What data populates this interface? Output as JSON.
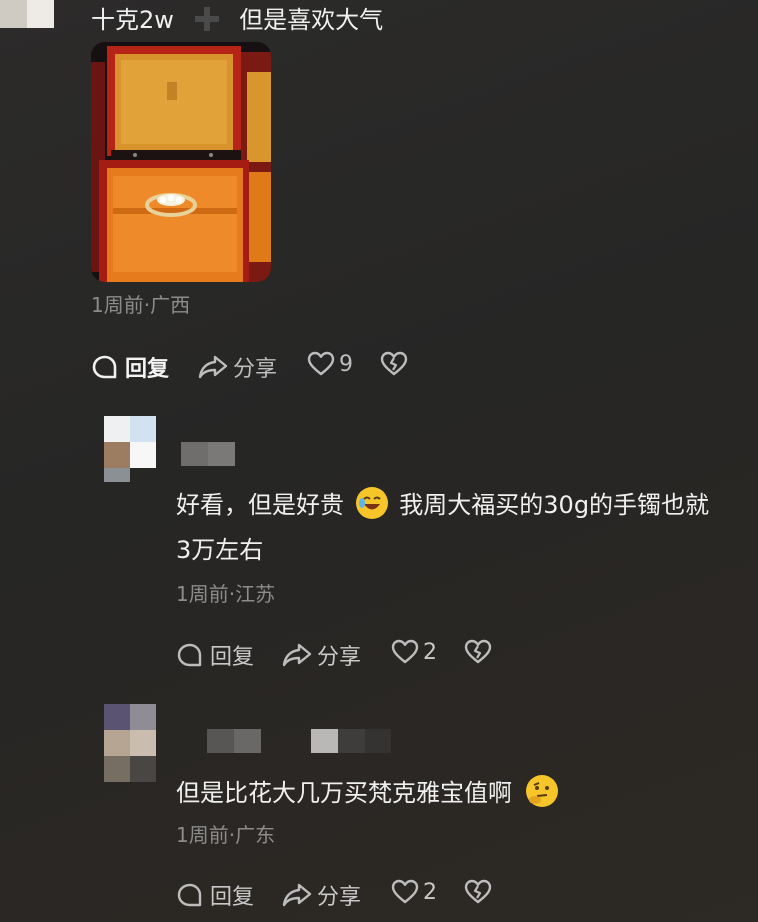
{
  "comment_top": {
    "text_before": "十克2w",
    "text_after": "但是喜欢大气",
    "meta": "1周前·广西",
    "actions": {
      "reply": "回复",
      "share": "分享",
      "likes": "9"
    }
  },
  "replies": [
    {
      "text_line1": "好看，但是好贵",
      "text_line1b": "我周大福买的30g的手镯也就",
      "text_line2": "3万左右",
      "meta": "1周前·江苏",
      "actions": {
        "reply": "回复",
        "share": "分享",
        "likes": "2"
      }
    },
    {
      "text": "但是比花大几万买梵克雅宝值啊",
      "meta": "1周前·广东",
      "actions": {
        "reply": "回复",
        "share": "分享",
        "likes": "2"
      }
    }
  ],
  "icons": [
    "avatar-blurred",
    "plus-icon",
    "ring-photo",
    "reply-icon",
    "share-icon",
    "heart-icon",
    "broken-heart-icon",
    "laughing-emoji",
    "thinking-emoji"
  ]
}
